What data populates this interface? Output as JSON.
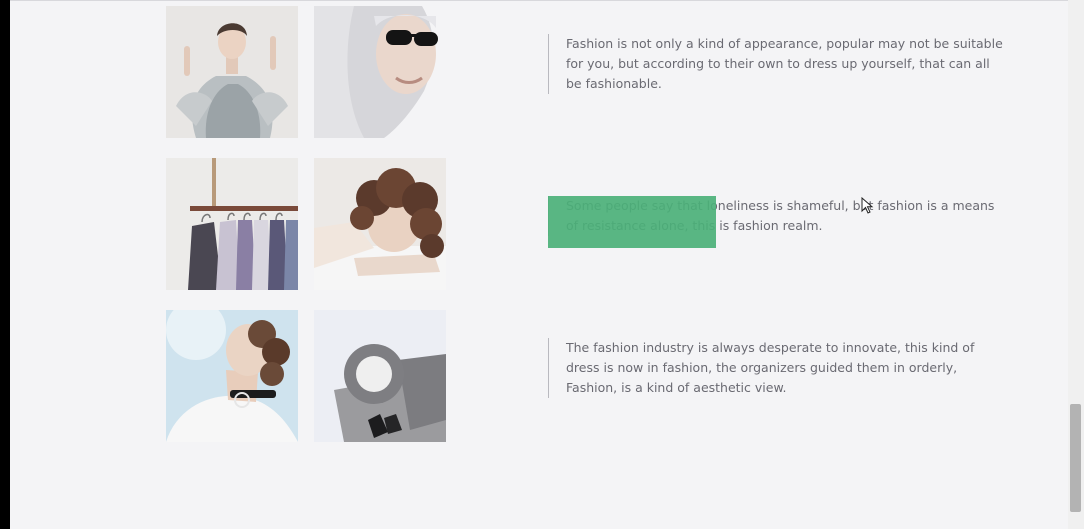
{
  "rows": [
    {
      "text": "Fashion is not only a kind of appearance, popular may not be suitable for you, but according to their own to dress up yourself, that can all be fashionable."
    },
    {
      "text": "Some people say that loneliness is shameful, but fashion is a means of resistance alone, this is fashion realm."
    },
    {
      "text": "The fashion industry is always desperate to innovate, this kind of dress is now in fashion, the organizers guided them in orderly, Fashion, is a kind of aesthetic view."
    }
  ],
  "colors": {
    "page_background": "#f4f4f6",
    "body_text": "#6a6a72",
    "divider": "#b9b9bf",
    "selection_highlight": "#4bb078",
    "scrollbar_thumb": "#b3b3b3"
  },
  "scroll": {
    "position_fraction": 0.92
  }
}
